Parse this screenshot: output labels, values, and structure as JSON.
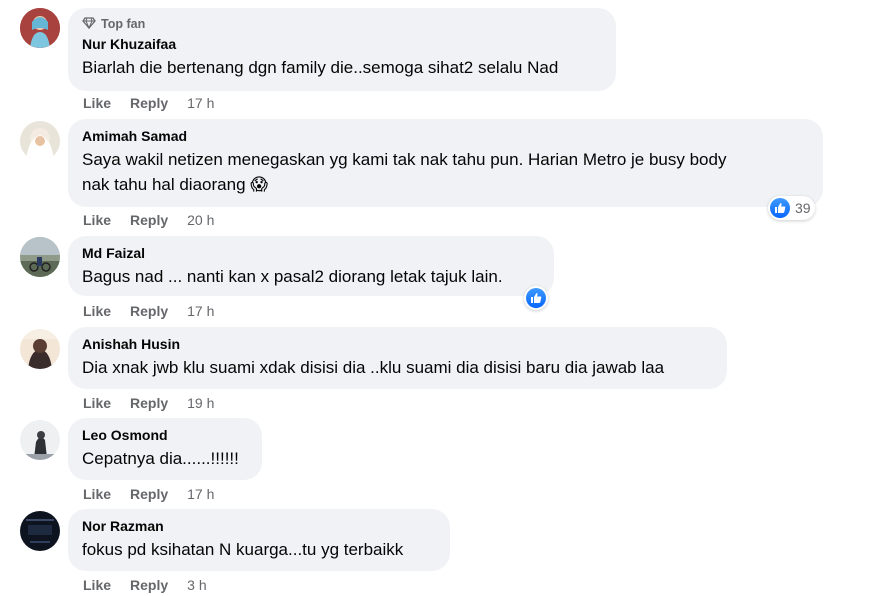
{
  "comments": [
    {
      "badge": "Top fan",
      "name": "Nur Khuzaifaa",
      "text": "Biarlah die bertenang dgn family die..semoga sihat2 selalu Nad",
      "like": "Like",
      "reply": "Reply",
      "time": "17 h"
    },
    {
      "name": "Amimah Samad",
      "text_line1": "Saya wakil netizen menegaskan yg kami tak nak tahu pun. Harian Metro je busy body",
      "text_line2": "nak tahu hal diaorang",
      "emoji": "😱",
      "like": "Like",
      "reply": "Reply",
      "time": "20 h",
      "reaction_count": "39"
    },
    {
      "name": "Md Faizal",
      "text": "Bagus nad ... nanti kan x pasal2 diorang letak tajuk lain.",
      "like": "Like",
      "reply": "Reply",
      "time": "17 h"
    },
    {
      "name": "Anishah Husin",
      "text": "Dia xnak jwb klu suami xdak disisi dia ..klu suami dia disisi baru dia jawab laa",
      "like": "Like",
      "reply": "Reply",
      "time": "19 h"
    },
    {
      "name": "Leo Osmond",
      "text": "Cepatnya dia......!!!!!!",
      "like": "Like",
      "reply": "Reply",
      "time": "17 h"
    },
    {
      "name": "Nor Razman",
      "text": "fokus pd ksihatan N kuarga...tu yg terbaikk",
      "like": "Like",
      "reply": "Reply",
      "time": "3 h"
    }
  ],
  "colors": {
    "bubble": "#f0f2f5",
    "secondary_text": "#65676b",
    "like_blue": "#0866ff"
  },
  "icons": [
    "diamond-icon",
    "like-reaction-icon"
  ]
}
